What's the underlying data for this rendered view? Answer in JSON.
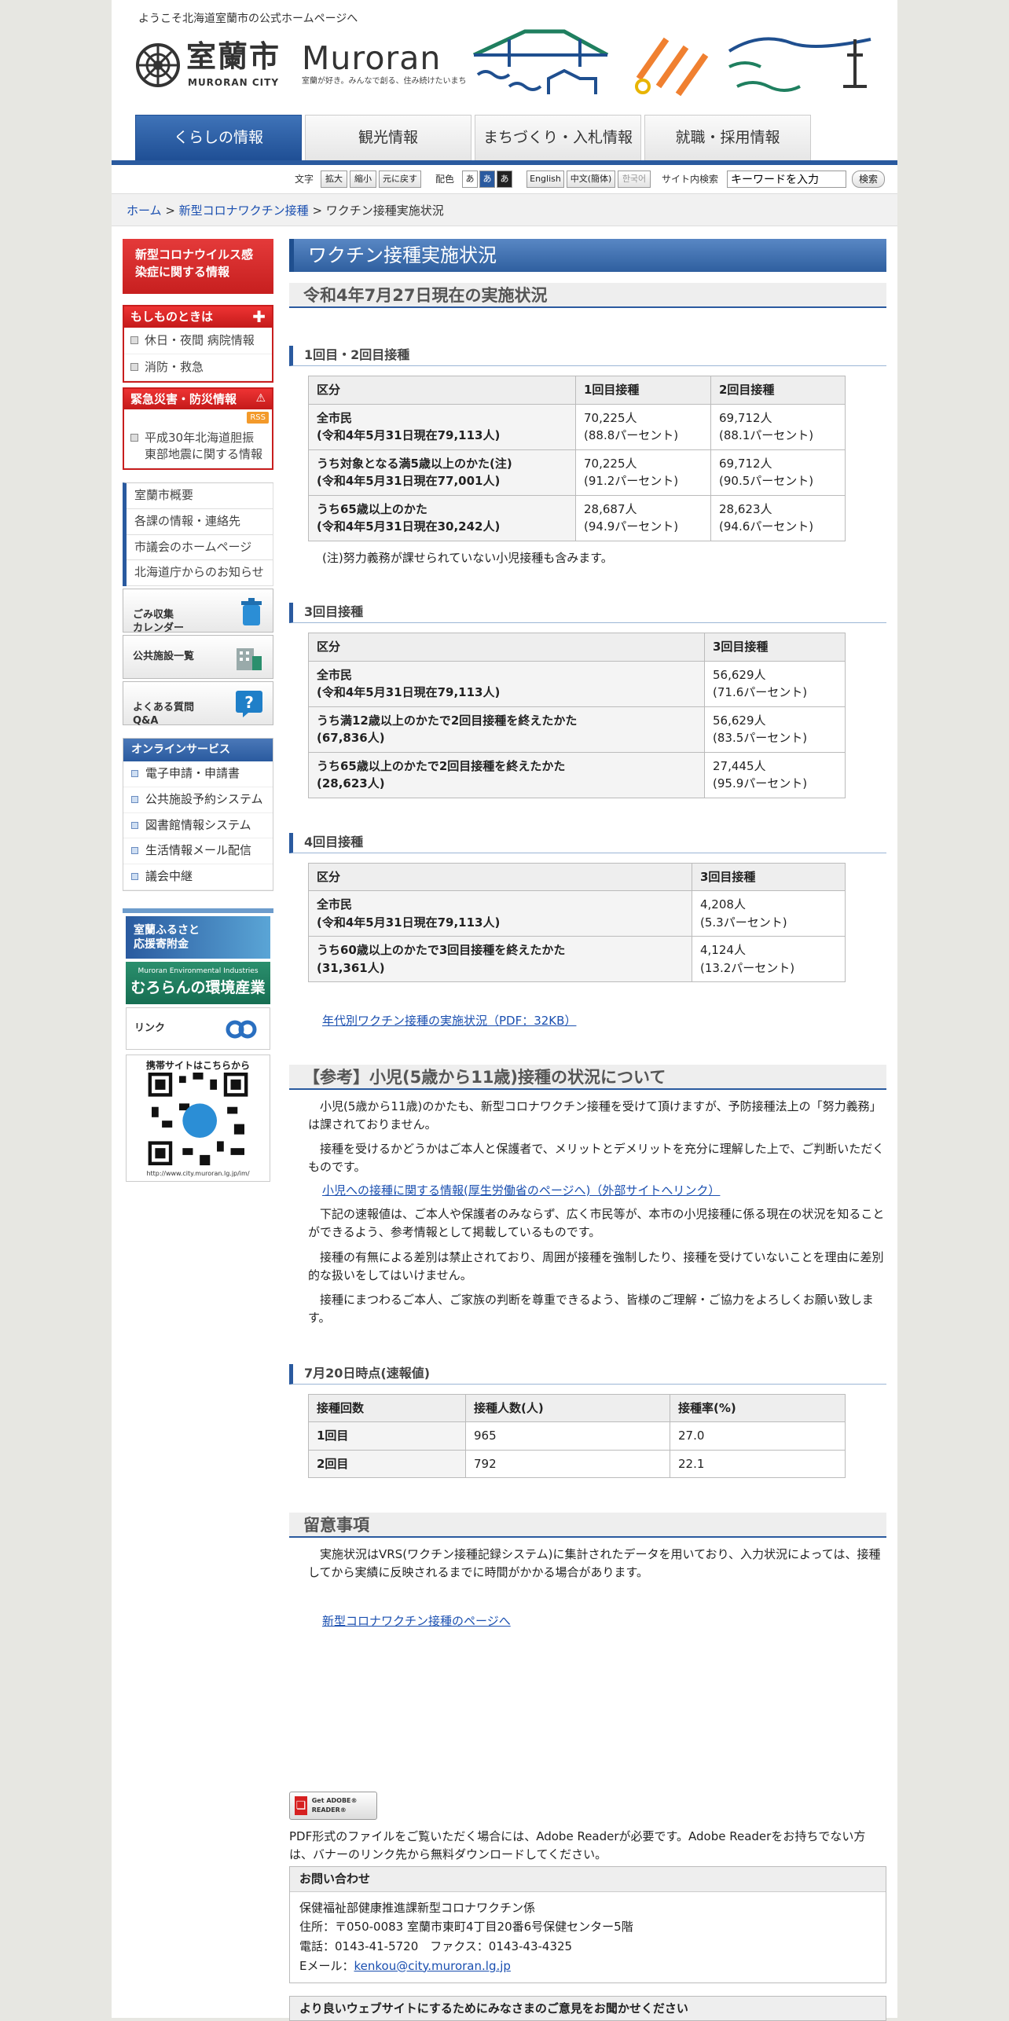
{
  "header": {
    "greeting": "ようこそ北海道室蘭市の公式ホームページへ",
    "logo_ja": "室蘭市",
    "logo_en": "MURORAN CITY",
    "logo_roman": "Muroran",
    "tagline": "室蘭が好き。みんなで創る、住み続けたいまち"
  },
  "global_nav": [
    {
      "label": "くらしの情報",
      "active": true
    },
    {
      "label": "観光情報",
      "active": false
    },
    {
      "label": "まちづくり・入札情報",
      "active": false
    },
    {
      "label": "就職・採用情報",
      "active": false
    }
  ],
  "tools": {
    "text_label": "文字",
    "enlarge": "拡大",
    "shrink": "縮小",
    "reset": "元に戻す",
    "color_label": "配色",
    "color_a": "あ",
    "color_b": "あ",
    "color_c": "あ",
    "english": "English",
    "chinese": "中文(簡体)",
    "korean": "한국어",
    "search_label": "サイト内検索",
    "search_placeholder": "キーワードを入力",
    "search_button": "検索"
  },
  "breadcrumb": {
    "home": "ホーム",
    "sep1": " > ",
    "parent": "新型コロナワクチン接種",
    "sep2": " > ",
    "current": "ワクチン接種実施状況"
  },
  "sidebar": {
    "covid_button": "新型コロナウイルス感染症に関する情報",
    "emergency_title": "もしものときは",
    "emergency_items": [
      "休日・夜間 病院情報",
      "消防・救急"
    ],
    "disaster_title": "緊急災害・防災情報",
    "rss": "RSS",
    "disaster_items": [
      "平成30年北海道胆振東部地震に関する情報"
    ],
    "menu_items": [
      "室蘭市概要",
      "各課の情報・連絡先",
      "市議会のホームページ",
      "北海道庁からのお知らせ"
    ],
    "btn_garbage": "ごみ収集\nカレンダー",
    "btn_facility": "公共施設一覧",
    "btn_faq": "よくある質問\nQ&A",
    "online_title": "オンラインサービス",
    "online_items": [
      "電子申請・申請書",
      "公共施設予約システム",
      "図書館情報システム",
      "生活情報メール配信",
      "議会中継"
    ],
    "banner1": "室蘭ふるさと\n応援寄附金",
    "banner2_small": "Muroran Environmental Industries",
    "banner2_large": "むろらんの環境産業",
    "banner3": "リンク",
    "qr_title": "携帯サイトはこちらから",
    "qr_url": "http://www.city.muroran.lg.jp/im/"
  },
  "main": {
    "title": "ワクチン接種実施状況",
    "status_date": "令和4年7月27日現在の実施状況",
    "section1": {
      "heading": "1回目・2回目接種",
      "headers": [
        "区分",
        "1回目接種",
        "2回目接種"
      ],
      "rows": [
        {
          "label": "全市民\n(令和4年5月31日現在79,113人)",
          "c1": "70,225人\n(88.8パーセント)",
          "c2": "69,712人\n(88.1パーセント)"
        },
        {
          "label": "うち対象となる満5歳以上のかた(注)\n(令和4年5月31日現在77,001人)",
          "c1": "70,225人\n(91.2パーセント)",
          "c2": "69,712人\n(90.5パーセント)"
        },
        {
          "label": "うち65歳以上のかた\n(令和4年5月31日現在30,242人)",
          "c1": "28,687人\n(94.9パーセント)",
          "c2": "28,623人\n(94.6パーセント)"
        }
      ],
      "note": "(注)努力義務が課せられていない小児接種も含みます。"
    },
    "section2": {
      "heading": "3回目接種",
      "headers": [
        "区分",
        "3回目接種"
      ],
      "rows": [
        {
          "label": "全市民\n(令和4年5月31日現在79,113人)",
          "c1": "56,629人\n(71.6パーセント)"
        },
        {
          "label": "うち満12歳以上のかたで2回目接種を終えたかた\n(67,836人)",
          "c1": "56,629人\n(83.5パーセント)"
        },
        {
          "label": "うち65歳以上のかたで2回目接種を終えたかた\n(28,623人)",
          "c1": "27,445人\n(95.9パーセント)"
        }
      ]
    },
    "section3": {
      "heading": "4回目接種",
      "headers": [
        "区分",
        "3回目接種"
      ],
      "rows": [
        {
          "label": "全市民\n(令和4年5月31日現在79,113人)",
          "c1": "4,208人\n(5.3パーセント)"
        },
        {
          "label": "うち60歳以上のかたで3回目接種を終えたかた\n(31,361人)",
          "c1": "4,124人\n(13.2パーセント)"
        }
      ]
    },
    "pdf_link": "年代別ワクチン接種の実施状況（PDF：32KB）",
    "ref_heading": "【参考】小児(5歳から11歳)接種の状況について",
    "ref_para1": "小児(5歳から11歳)のかたも、新型コロナワクチン接種を受けて頂けますが、予防接種法上の「努力義務」は課されておりません。",
    "ref_para2": "接種を受けるかどうかはご本人と保護者で、メリットとデメリットを充分に理解した上で、ご判断いただくものです。",
    "ref_link": "小児への接種に関する情報(厚生労働省のページへ)（外部サイトへリンク）",
    "ref_para3": "下記の速報値は、ご本人や保護者のみならず、広く市民等が、本市の小児接種に係る現在の状況を知ることができるよう、参考情報として掲載しているものです。",
    "ref_para4": "接種の有無による差別は禁止されており、周囲が接種を強制したり、接種を受けていないことを理由に差別的な扱いをしてはいけません。",
    "ref_para5": "接種にまつわるご本人、ご家族の判断を尊重できるよう、皆様のご理解・ご協力をよろしくお願い致します。",
    "child": {
      "heading": "7月20日時点(速報値)",
      "headers": [
        "接種回数",
        "接種人数(人)",
        "接種率(%)"
      ],
      "rows": [
        {
          "dose": "1回目",
          "count": "965",
          "rate": "27.0"
        },
        {
          "dose": "2回目",
          "count": "792",
          "rate": "22.1"
        }
      ]
    },
    "notice_heading": "留意事項",
    "notice_text": "実施状況はVRS(ワクチン接種記録システム)に集計されたデータを用いており、入力状況によっては、接種してから実績に反映されるまでに時間がかかる場合があります。",
    "back_link": "新型コロナワクチン接種のページへ"
  },
  "footer": {
    "adobe_badge": "Get ADOBE® READER®",
    "adobe_text": "PDF形式のファイルをご覧いただく場合には、Adobe Readerが必要です。Adobe Readerをお持ちでない方は、バナーのリンク先から無料ダウンロードしてください。",
    "contact_title": "お問い合わせ",
    "contact_dept": "保健福祉部健康推進課新型コロナワクチン係",
    "contact_address": "住所：〒050-0083 室蘭市東町4丁目20番6号保健センター5階",
    "contact_phone": "電話：0143-41-5720　ファクス：0143-43-4325",
    "contact_email_label": "Eメール：",
    "contact_email": "kenkou@city.muroran.lg.jp",
    "opinion_title": "より良いウェブサイトにするためにみなさまのご意見をお聞かせください"
  }
}
